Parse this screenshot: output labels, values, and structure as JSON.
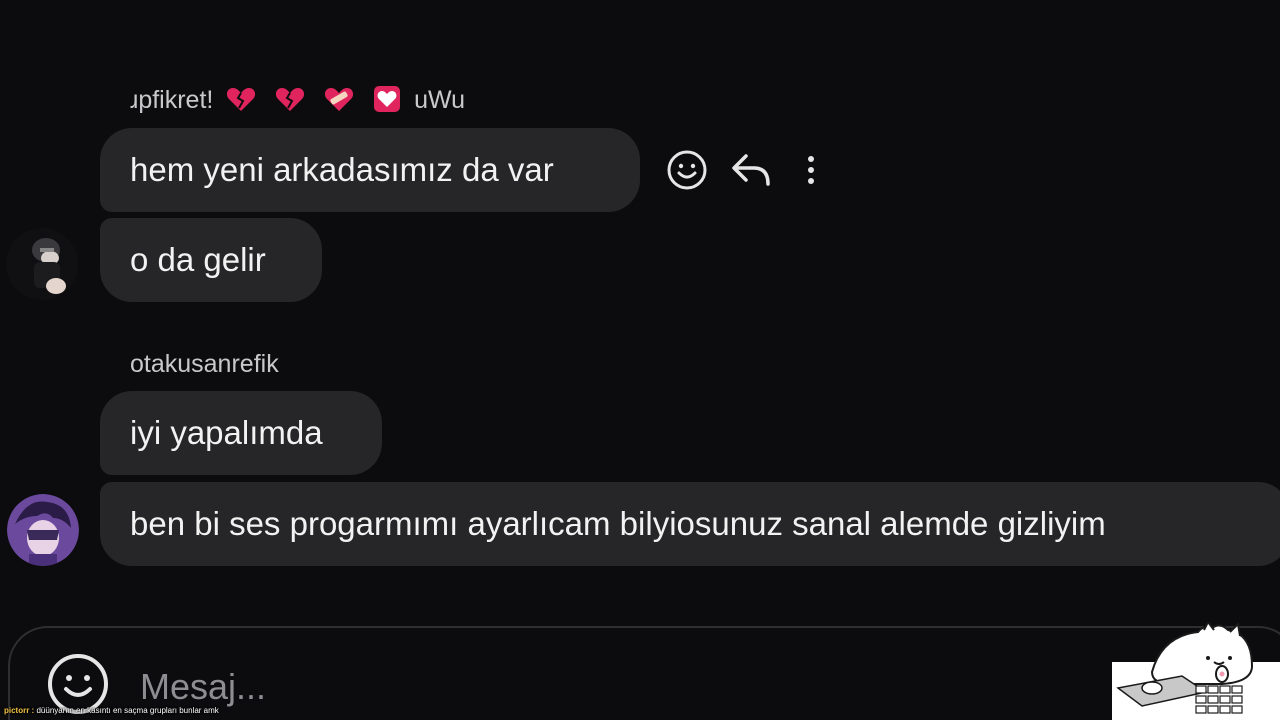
{
  "messages": [
    {
      "sender": "ɹpfikret!",
      "sender_suffix": "uWu",
      "text": "hem yeni arkadasımız da var"
    },
    {
      "text": "o da gelir"
    },
    {
      "sender": "otakusanrefik",
      "text": "iyi yapalımda"
    },
    {
      "text": "ben bi ses progarmımı ayarlıcam bilyiosunuz sanal alemde gizliyim"
    }
  ],
  "message_actions": {
    "icons": [
      "smiley-icon",
      "reply-icon",
      "more-vertical-icon"
    ]
  },
  "composer": {
    "placeholder": "Mesaj..."
  },
  "caption": {
    "prefix": "pictorr :",
    "text": "düünyanın en kasıntı en saçma grupları bunlar amk"
  },
  "colors": {
    "background": "#0c0c0e",
    "bubble": "#262628",
    "text": "#f2f2f2",
    "muted_text": "#c9c9cc",
    "placeholder": "#8d8d92",
    "heart_red": "#e0245e"
  }
}
